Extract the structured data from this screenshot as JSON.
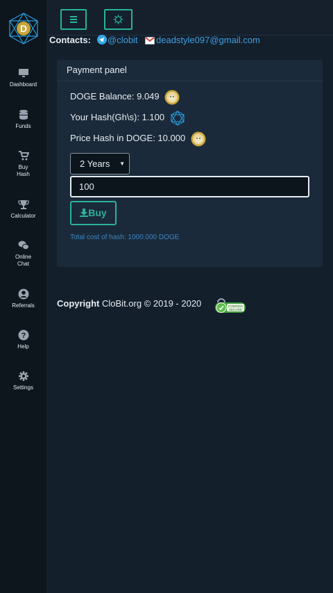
{
  "sidebar": {
    "items": [
      {
        "label_lines": [
          "Dashboard"
        ],
        "icon": "monitor-icon"
      },
      {
        "label_lines": [
          "Funds"
        ],
        "icon": "database-icon"
      },
      {
        "label_lines": [
          "Buy",
          "Hash"
        ],
        "icon": "cart-icon"
      },
      {
        "label_lines": [
          "Calculator"
        ],
        "icon": "trophy-icon"
      },
      {
        "label_lines": [
          "Online",
          "Chat"
        ],
        "icon": "chat-icon"
      },
      {
        "label_lines": [
          "Referrals"
        ],
        "icon": "user-circle-icon"
      },
      {
        "label_lines": [
          "Help"
        ],
        "icon": "question-icon"
      },
      {
        "label_lines": [
          "Settings"
        ],
        "icon": "gear-icon"
      }
    ]
  },
  "contacts": {
    "label": "Contacts:",
    "telegram": "@clobit",
    "email": "deadstyle097@gmail.com"
  },
  "panel": {
    "title": "Payment panel",
    "balance": "DOGE Balance: 9.049",
    "hash": "Your Hash(Gh\\s): 1.100",
    "price": "Price Hash in DOGE: 10.000",
    "period": "2 Years",
    "amount": "100",
    "buy_label": "Buy",
    "total": "Total cost of hash: 1000.000 DOGE"
  },
  "footer": {
    "copyright_word": "Copyright",
    "rest": " CloBit.org © 2019 - 2020",
    "badge_top": "COMODO",
    "badge_bottom": "SECURE"
  },
  "colors": {
    "accent": "#2ab39b",
    "link": "#3f9fe0",
    "background": "#141f2c",
    "panel": "#1b2a3a"
  }
}
